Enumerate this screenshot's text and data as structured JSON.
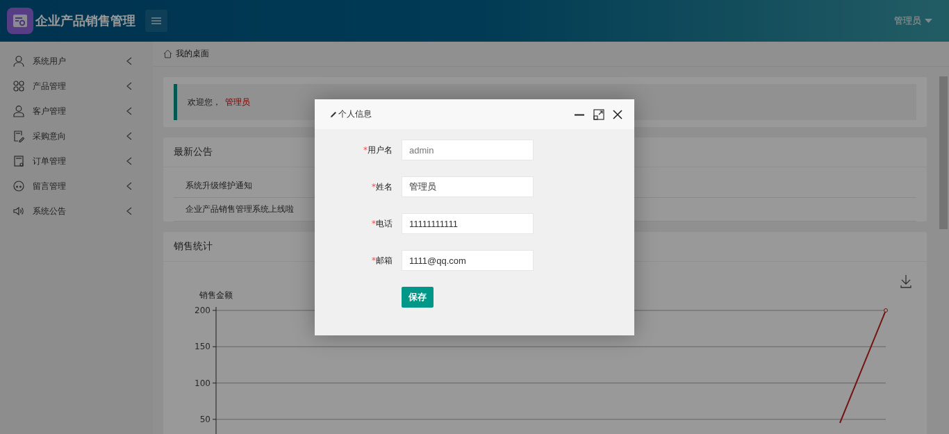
{
  "header": {
    "title": "企业产品销售管理",
    "user": "管理员"
  },
  "sidebar": {
    "items": [
      {
        "label": "系统用户",
        "expanded": false
      },
      {
        "label": "产品管理",
        "expanded": false
      },
      {
        "label": "客户管理",
        "expanded": false
      },
      {
        "label": "采购意向",
        "expanded": false
      },
      {
        "label": "订单管理",
        "expanded": false
      },
      {
        "label": "留言管理",
        "expanded": false
      },
      {
        "label": "系统公告",
        "expanded": false
      }
    ]
  },
  "breadcrumb": "我的桌面",
  "welcome": {
    "greeting": "欢迎您，",
    "name": "管理员"
  },
  "notices": {
    "title": "最新公告",
    "items": [
      "系统升级维护通知",
      "企业产品销售管理系统上线啦"
    ]
  },
  "sales": {
    "title": "销售统计",
    "y_axis_label": "销售金额",
    "y_tick_labels": [
      "200",
      "150",
      "100",
      "50"
    ]
  },
  "dialog": {
    "title": "个人信息",
    "fields": [
      {
        "mark": "*",
        "label": "用户名",
        "value": "admin",
        "disabled": true
      },
      {
        "mark": "*",
        "label": "姓名",
        "value": "管理员",
        "disabled": false
      },
      {
        "mark": "*",
        "label": "电话",
        "value": "11111111111",
        "disabled": false
      },
      {
        "mark": "*",
        "label": "邮箱",
        "value": "1111@qq.com",
        "disabled": false
      }
    ],
    "button": "保存"
  }
}
